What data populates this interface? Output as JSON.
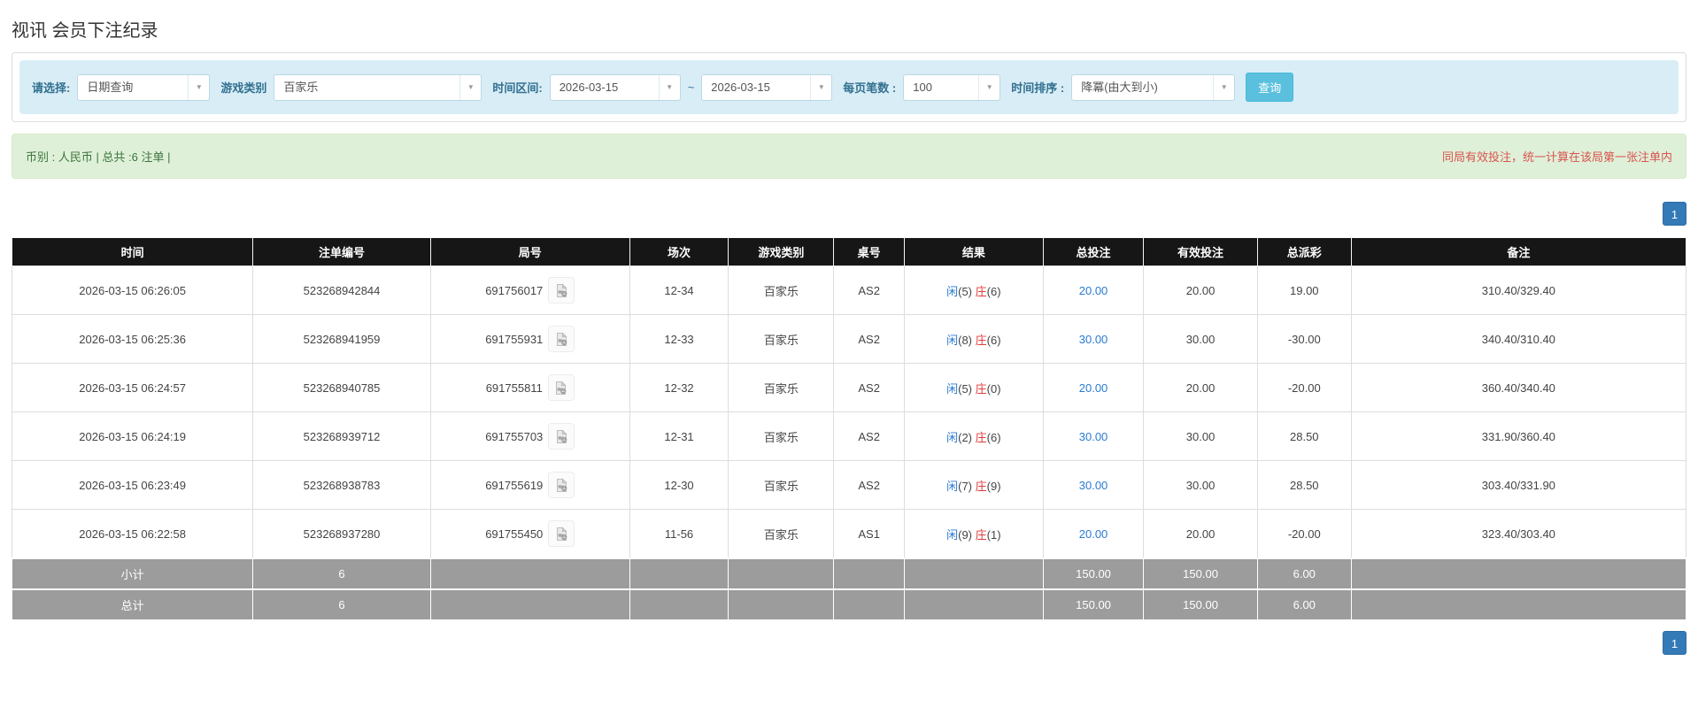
{
  "page": {
    "title": "视讯 会员下注纪录"
  },
  "filters": {
    "select_label": "请选择:",
    "select_value": "日期查询",
    "game_type_label": "游戏类别",
    "game_type_value": "百家乐",
    "time_range_label": "时间区间:",
    "date_from": "2026-03-15",
    "tilde": "~",
    "date_to": "2026-03-15",
    "per_page_label": "每页笔数 :",
    "per_page_value": "100",
    "sort_label": "时间排序 :",
    "sort_value": "降冪(由大到小)",
    "search_button": "查询"
  },
  "icons": {
    "caret_down": "▼",
    "video_icon_name": "video-file-icon"
  },
  "colors": {
    "accent_blue": "#2a7ad2",
    "accent_red": "#e03c3c",
    "header_bg": "#161616",
    "info_bg": "#d9edf7",
    "success_bg": "#dff0d8",
    "button_info": "#5bc0de",
    "pagination_blue": "#337ab7",
    "summary_row_gray": "#9c9c9c"
  },
  "summary_bar": {
    "left_text": "币别 : 人民币 | 总共 :6 注单 |",
    "right_text": "同局有效投注，统一计算在该局第一张注单内"
  },
  "pagination": {
    "page": "1"
  },
  "table": {
    "headers": [
      "时间",
      "注单编号",
      "局号",
      "场次",
      "游戏类别",
      "桌号",
      "结果",
      "总投注",
      "有效投注",
      "总派彩",
      "备注"
    ],
    "result_player_label": "闲",
    "result_banker_label": "庄",
    "rows": [
      {
        "time": "2026-03-15 06:26:05",
        "bet_id": "523268942844",
        "round_id": "691756017",
        "session": "12-34",
        "game": "百家乐",
        "table_no": "AS2",
        "player_score": "(5)",
        "banker_score": "(6)",
        "total_bet": "20.00",
        "valid_bet": "20.00",
        "payout": "19.00",
        "remark": "310.40/329.40"
      },
      {
        "time": "2026-03-15 06:25:36",
        "bet_id": "523268941959",
        "round_id": "691755931",
        "session": "12-33",
        "game": "百家乐",
        "table_no": "AS2",
        "player_score": "(8)",
        "banker_score": "(6)",
        "total_bet": "30.00",
        "valid_bet": "30.00",
        "payout": "-30.00",
        "remark": "340.40/310.40"
      },
      {
        "time": "2026-03-15 06:24:57",
        "bet_id": "523268940785",
        "round_id": "691755811",
        "session": "12-32",
        "game": "百家乐",
        "table_no": "AS2",
        "player_score": "(5)",
        "banker_score": "(0)",
        "total_bet": "20.00",
        "valid_bet": "20.00",
        "payout": "-20.00",
        "remark": "360.40/340.40"
      },
      {
        "time": "2026-03-15 06:24:19",
        "bet_id": "523268939712",
        "round_id": "691755703",
        "session": "12-31",
        "game": "百家乐",
        "table_no": "AS2",
        "player_score": "(2)",
        "banker_score": "(6)",
        "total_bet": "30.00",
        "valid_bet": "30.00",
        "payout": "28.50",
        "remark": "331.90/360.40"
      },
      {
        "time": "2026-03-15 06:23:49",
        "bet_id": "523268938783",
        "round_id": "691755619",
        "session": "12-30",
        "game": "百家乐",
        "table_no": "AS2",
        "player_score": "(7)",
        "banker_score": "(9)",
        "total_bet": "30.00",
        "valid_bet": "30.00",
        "payout": "28.50",
        "remark": "303.40/331.90"
      },
      {
        "time": "2026-03-15 06:22:58",
        "bet_id": "523268937280",
        "round_id": "691755450",
        "session": "11-56",
        "game": "百家乐",
        "table_no": "AS1",
        "player_score": "(9)",
        "banker_score": "(1)",
        "total_bet": "20.00",
        "valid_bet": "20.00",
        "payout": "-20.00",
        "remark": "323.40/303.40"
      }
    ],
    "subtotal": {
      "label": "小计",
      "count": "6",
      "total_bet": "150.00",
      "valid_bet": "150.00",
      "payout": "6.00"
    },
    "total": {
      "label": "总计",
      "count": "6",
      "total_bet": "150.00",
      "valid_bet": "150.00",
      "payout": "6.00"
    }
  }
}
